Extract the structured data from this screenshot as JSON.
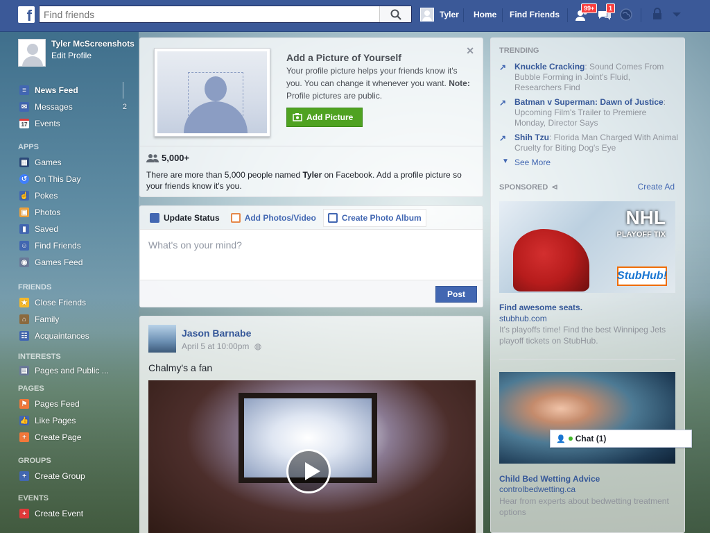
{
  "topbar": {
    "logo": "f",
    "search_placeholder": "Find friends",
    "user_name": "Tyler",
    "home": "Home",
    "find_friends": "Find Friends",
    "friend_requests_badge": "99+",
    "messages_badge": "1"
  },
  "profile": {
    "name": "Tyler McScreenshots",
    "edit": "Edit Profile"
  },
  "sidebar": {
    "favorites": [
      {
        "label": "News Feed",
        "icon": "news-feed-icon",
        "color": "#4267b2"
      },
      {
        "label": "Messages",
        "icon": "messages-icon",
        "count": "2",
        "color": "#4267b2"
      },
      {
        "label": "Events",
        "icon": "calendar-icon",
        "badge": "17",
        "color": "#ffffff"
      }
    ],
    "apps_title": "APPS",
    "apps": [
      {
        "label": "Games",
        "icon": "games-icon",
        "color": "#2c4a7a"
      },
      {
        "label": "On This Day",
        "icon": "on-this-day-icon",
        "color": "#4080ff"
      },
      {
        "label": "Pokes",
        "icon": "poke-icon",
        "color": "#4267b2"
      },
      {
        "label": "Photos",
        "icon": "photos-icon",
        "color": "#f2a33a"
      },
      {
        "label": "Saved",
        "icon": "saved-icon",
        "color": "#4267b2"
      },
      {
        "label": "Find Friends",
        "icon": "find-friends-icon",
        "color": "#4267b2"
      },
      {
        "label": "Games Feed",
        "icon": "games-feed-icon",
        "color": "#6a7a9a"
      }
    ],
    "friends_title": "FRIENDS",
    "friends": [
      {
        "label": "Close Friends",
        "icon": "star-icon",
        "color": "#f7b928"
      },
      {
        "label": "Family",
        "icon": "family-icon",
        "color": "#8b6a3e"
      },
      {
        "label": "Acquaintances",
        "icon": "acquaintances-icon",
        "color": "#4267b2"
      }
    ],
    "interests_title": "INTERESTS",
    "interests": [
      {
        "label": "Pages and Public ...",
        "icon": "pages-public-icon",
        "color": "#6a7a9a"
      }
    ],
    "pages_title": "PAGES",
    "pages": [
      {
        "label": "Pages Feed",
        "icon": "pages-feed-icon",
        "color": "#f2783a"
      },
      {
        "label": "Like Pages",
        "icon": "thumbs-up-icon",
        "color": "#4267b2"
      },
      {
        "label": "Create Page",
        "icon": "create-page-icon",
        "color": "#f2783a"
      }
    ],
    "groups_title": "GROUPS",
    "groups": [
      {
        "label": "Create Group",
        "icon": "create-group-icon",
        "color": "#4267b2"
      }
    ],
    "events_title": "EVENTS",
    "events": [
      {
        "label": "Create Event",
        "icon": "create-event-icon",
        "color": "#e03a3a"
      }
    ]
  },
  "profile_prompt": {
    "title": "Add a Picture of Yourself",
    "text": "Your profile picture helps your friends know it's you. You can change it whenever you want.",
    "note_label": "Note:",
    "note_text": "Profile pictures are public.",
    "button": "Add Picture",
    "count": "5,000+",
    "info_before": "There are more than 5,000 people named ",
    "info_name": "Tyler",
    "info_after": " on Facebook. Add a profile picture so your friends know it's you."
  },
  "composer": {
    "tabs": [
      "Update Status",
      "Add Photos/Video",
      "Create Photo Album"
    ],
    "placeholder": "What's on your mind?",
    "post": "Post"
  },
  "story": {
    "author": "Jason Barnabe",
    "time": "April 5 at 10:00pm",
    "text": "Chalmy's a fan"
  },
  "right": {
    "trending_title": "TRENDING",
    "trends": [
      {
        "topic": "Knuckle Cracking",
        "desc": ": Sound Comes From Bubble Forming in Joint's Fluid, Researchers Find"
      },
      {
        "topic": "Batman v Superman: Dawn of Justice",
        "desc": ": Upcoming Film's Trailer to Premiere Monday, Director Says"
      },
      {
        "topic": "Shih Tzu",
        "desc": ": Florida Man Charged With Animal Cruelty for Biting Dog's Eye"
      }
    ],
    "see_more": "See More",
    "sponsored_title": "SPONSORED",
    "create_ad": "Create Ad",
    "ad1": {
      "headline_img": "NHL",
      "sub_img": "PLAYOFF TIX",
      "logo": "StubHub!",
      "title": "Find awesome seats.",
      "domain": "stubhub.com",
      "desc": "It's playoffs time! Find the best Winnipeg Jets playoff tickets on StubHub."
    },
    "ad2": {
      "title": "Child Bed Wetting Advice",
      "domain": "controlbedwetting.ca",
      "desc": "Hear from experts about bedwetting treatment options"
    }
  },
  "chat": {
    "label": "Chat (1)"
  }
}
